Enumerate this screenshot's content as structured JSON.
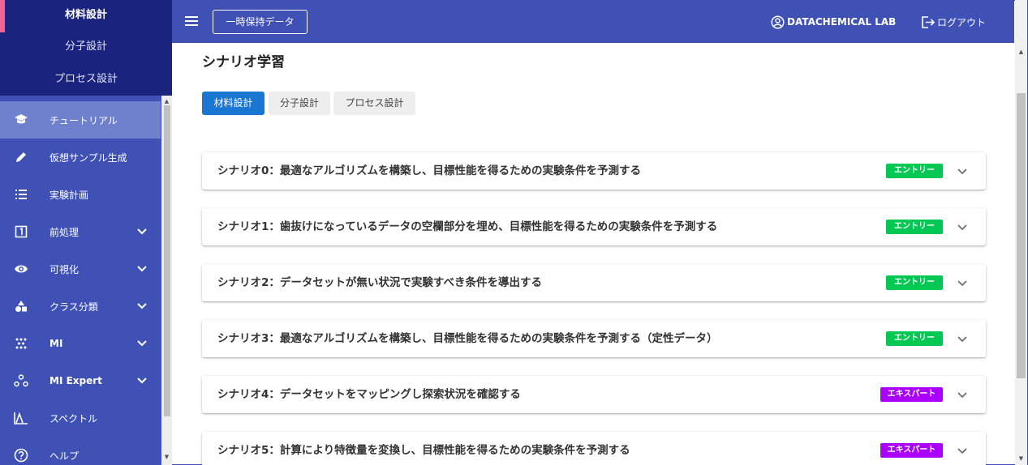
{
  "sidebar": {
    "modes": [
      {
        "label": "材料設計"
      },
      {
        "label": "分子設計"
      },
      {
        "label": "プロセス設計"
      }
    ],
    "items": [
      {
        "label": "チュートリアル",
        "icon": "graduation-cap-icon"
      },
      {
        "label": "仮想サンプル生成",
        "icon": "pencil-icon"
      },
      {
        "label": "実験計画",
        "icon": "list-icon"
      },
      {
        "label": "前処理",
        "icon": "numbered-box-icon",
        "expandable": true
      },
      {
        "label": "可視化",
        "icon": "eye-icon",
        "expandable": true
      },
      {
        "label": "クラス分類",
        "icon": "shapes-icon",
        "expandable": true
      },
      {
        "label": "MI",
        "icon": "scatter-icon",
        "expandable": true
      },
      {
        "label": "MI Expert",
        "icon": "network-icon",
        "expandable": true
      },
      {
        "label": "スペクトル",
        "icon": "spectrum-icon"
      },
      {
        "label": "ヘルプ",
        "icon": "help-icon"
      }
    ]
  },
  "header": {
    "temp_button": "一時保持データ",
    "lab_name": "DATACHEMICAL LAB",
    "logout": "ログアウト"
  },
  "main": {
    "title": "シナリオ学習",
    "tabs": [
      {
        "label": "材料設計"
      },
      {
        "label": "分子設計"
      },
      {
        "label": "プロセス設計"
      }
    ],
    "scenarios": [
      {
        "title": "シナリオ0：最適なアルゴリズムを構築し、目標性能を得るための実験条件を予測する",
        "level": "エントリー"
      },
      {
        "title": "シナリオ1：歯抜けになっているデータの空欄部分を埋め、目標性能を得るための実験条件を予測する",
        "level": "エントリー"
      },
      {
        "title": "シナリオ2：データセットが無い状況で実験すべき条件を導出する",
        "level": "エントリー"
      },
      {
        "title": "シナリオ3：最適なアルゴリズムを構築し、目標性能を得るための実験条件を予測する（定性データ）",
        "level": "エントリー"
      },
      {
        "title": "シナリオ4：データセットをマッピングし探索状況を確認する",
        "level": "エキスパート"
      },
      {
        "title": "シナリオ5：計算により特徴量を変換し、目標性能を得るための実験条件を予測する",
        "level": "エキスパート"
      }
    ]
  },
  "colors": {
    "primary": "#3f51b5",
    "sidebar_dark": "#1a237e",
    "active_tab": "#1976d2",
    "entry_badge": "#00c853",
    "expert_badge": "#aa00ff",
    "accent_mark": "#f06292"
  }
}
